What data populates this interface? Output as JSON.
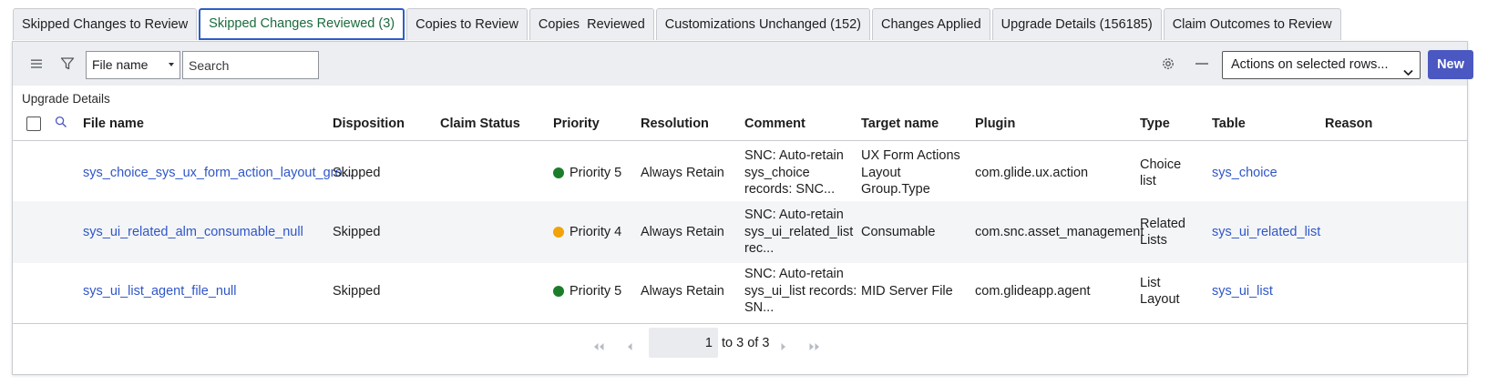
{
  "tabs": [
    {
      "label": "Skipped Changes to Review"
    },
    {
      "label": "Skipped Changes Reviewed (3)"
    },
    {
      "label": "Copies to Review"
    },
    {
      "label": "Copies  Reviewed"
    },
    {
      "label": "Customizations Unchanged (152)"
    },
    {
      "label": "Changes Applied"
    },
    {
      "label": "Upgrade Details (156185)"
    },
    {
      "label": "Claim Outcomes to Review"
    }
  ],
  "toolbar": {
    "field_select": "File name",
    "search_placeholder": "Search",
    "actions_label": "Actions on selected rows...",
    "new_label": "New"
  },
  "list": {
    "title": "Upgrade Details",
    "columns": {
      "file_name": "File name",
      "disposition": "Disposition",
      "claim_status": "Claim Status",
      "priority": "Priority",
      "resolution": "Resolution",
      "comment": "Comment",
      "target_name": "Target name",
      "plugin": "Plugin",
      "type": "Type",
      "table": "Table",
      "reason": "Reason"
    },
    "rows": [
      {
        "file_name": "sys_choice_sys_ux_form_action_layout_gro...",
        "disposition": "Skipped",
        "claim_status": "",
        "priority": "Priority 5",
        "priority_color": "#1b7d2a",
        "resolution": "Always Retain",
        "comment": [
          "SNC: Auto-retain",
          "sys_choice",
          "records: SNC..."
        ],
        "target_name": [
          "UX Form Actions",
          "Layout",
          "Group.Type"
        ],
        "plugin": "com.glide.ux.action",
        "type": [
          "Choice",
          "list"
        ],
        "table": "sys_choice",
        "reason": ""
      },
      {
        "file_name": "sys_ui_related_alm_consumable_null",
        "disposition": "Skipped",
        "claim_status": "",
        "priority": "Priority 4",
        "priority_color": "#f0a30a",
        "resolution": "Always Retain",
        "comment": [
          "SNC: Auto-retain",
          "sys_ui_related_list",
          "rec..."
        ],
        "target_name": [
          "Consumable"
        ],
        "plugin": "com.snc.asset_management",
        "type": [
          "Related",
          "Lists"
        ],
        "table": "sys_ui_related_list",
        "reason": ""
      },
      {
        "file_name": "sys_ui_list_agent_file_null",
        "disposition": "Skipped",
        "claim_status": "",
        "priority": "Priority 5",
        "priority_color": "#1b7d2a",
        "resolution": "Always Retain",
        "comment": [
          "SNC: Auto-retain",
          "sys_ui_list records:",
          "SN..."
        ],
        "target_name": [
          "MID Server File"
        ],
        "plugin": "com.glideapp.agent",
        "type": [
          "List",
          "Layout"
        ],
        "table": "sys_ui_list",
        "reason": ""
      }
    ]
  },
  "pagination": {
    "current_page": "1",
    "range_text": "to 3 of 3"
  }
}
